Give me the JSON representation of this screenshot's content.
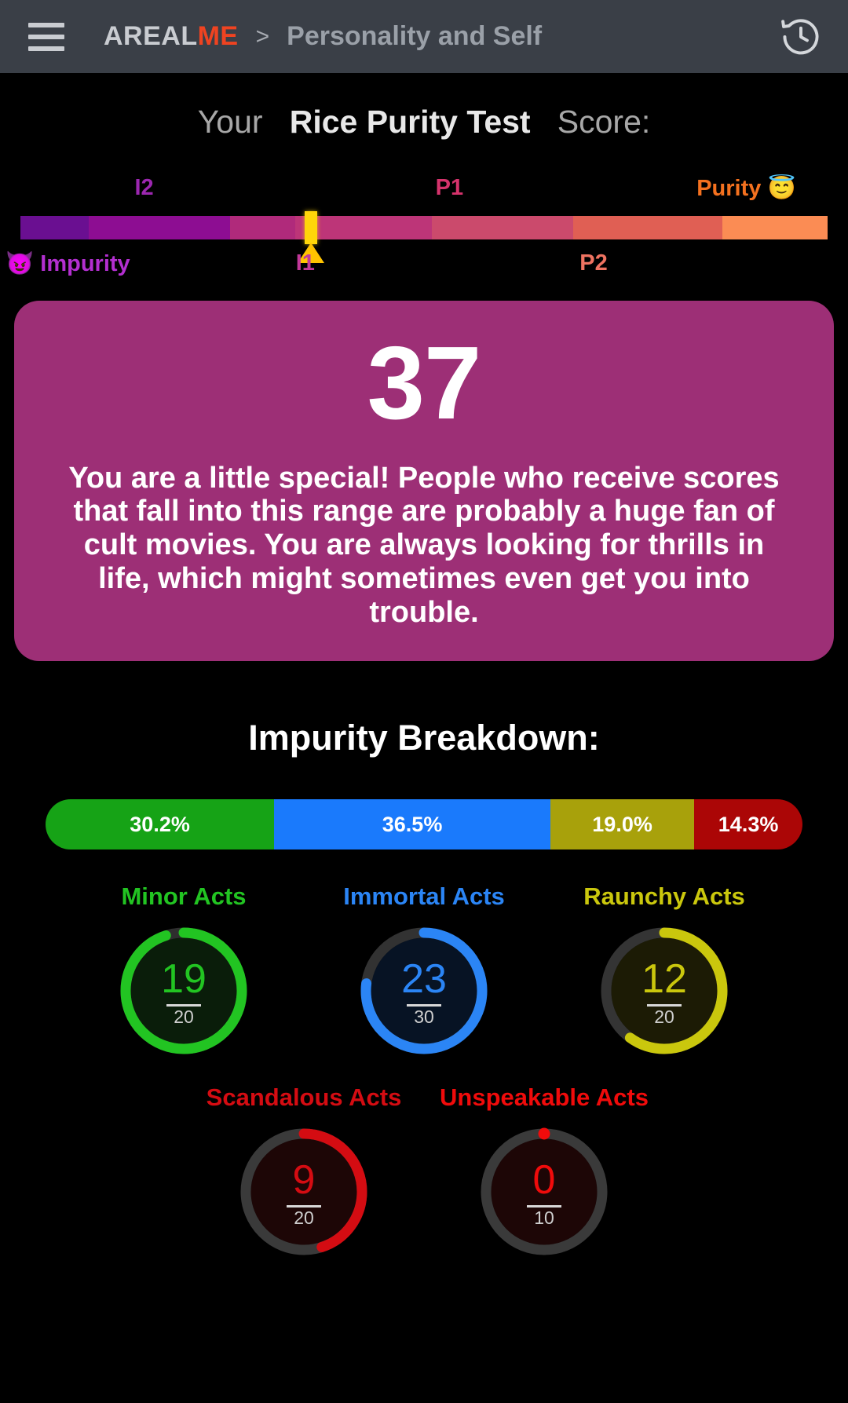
{
  "header": {
    "menu_icon": "hamburger-icon",
    "brand_part1": "AREAL",
    "brand_part2": "ME",
    "separator": ">",
    "breadcrumb": "Personality and Self",
    "history_icon": "history-clock-icon",
    "bg_color": "#3a3f47",
    "brand_accent": "#ef4321"
  },
  "title": {
    "prefix": "Your",
    "test_name": "Rice Purity Test",
    "suffix": "Score:"
  },
  "scale": {
    "top_labels": [
      {
        "text": "I2",
        "color": "#9c27b0",
        "pos_pct": 17
      },
      {
        "text": "P1",
        "color": "#d6336c",
        "pos_pct": 53
      },
      {
        "text": "Purity 😇",
        "color": "#f4711f",
        "pos_pct": 88
      }
    ],
    "bottom_labels": [
      {
        "text": "😈 Impurity",
        "color": "#b32fd0",
        "pos_pct": 8
      },
      {
        "text": "I1",
        "color": "#c2389a",
        "pos_pct": 36
      },
      {
        "text": "P2",
        "color": "#ef7361",
        "pos_pct": 70
      }
    ],
    "segments": [
      {
        "color": "#6a0f91",
        "width_pct": 8.5
      },
      {
        "color": "#8d0d92",
        "width_pct": 17.5
      },
      {
        "color": "#b02a7b",
        "width_pct": 8.0
      },
      {
        "color": "#bd3578",
        "width_pct": 17.0
      },
      {
        "color": "#cb4a6c",
        "width_pct": 17.5
      },
      {
        "color": "#e05f54",
        "width_pct": 18.5
      },
      {
        "color": "#fb8c54",
        "width_pct": 13.0
      }
    ],
    "marker_pct": 36.0,
    "marker_color": "#ffd60a"
  },
  "score_card": {
    "score": "37",
    "description": "You are a little special! People who receive scores that fall into this range are probably a huge fan of cult movies. You are always looking for thrills in life, which might sometimes even get you into trouble.",
    "bg_color": "#9d2f76"
  },
  "breakdown": {
    "heading": "Impurity Breakdown:",
    "segments": [
      {
        "label": "30.2%",
        "value": 30.2,
        "color": "#16a316"
      },
      {
        "label": "36.5%",
        "value": 36.5,
        "color": "#1a7afc"
      },
      {
        "label": "19.0%",
        "value": 19.0,
        "color": "#a8a10b"
      },
      {
        "label": "14.3%",
        "value": 14.3,
        "color": "#ab0606"
      }
    ]
  },
  "chart_data": {
    "type": "pie",
    "title": "Impurity Breakdown",
    "categories": [
      "Minor Acts",
      "Immortal Acts",
      "Raunchy Acts",
      "Scandalous Acts",
      "Unspeakable Acts"
    ],
    "values": [
      30.2,
      36.5,
      19.0,
      14.3,
      0.0
    ],
    "unit": "%",
    "note": "Stacked percentage bar shows only the four non-zero categories: 30.2%, 36.5%, 19.0%, 14.3%",
    "gauges": [
      {
        "name": "Minor Acts",
        "value": 19,
        "max": 20,
        "percent": 95.0,
        "color": "#22c422"
      },
      {
        "name": "Immortal Acts",
        "value": 23,
        "max": 30,
        "percent": 76.7,
        "color": "#2b85f5"
      },
      {
        "name": "Raunchy Acts",
        "value": 12,
        "max": 20,
        "percent": 60.0,
        "color": "#cac70d"
      },
      {
        "name": "Scandalous Acts",
        "value": 9,
        "max": 20,
        "percent": 45.0,
        "color": "#d40c12"
      },
      {
        "name": "Unspeakable Acts",
        "value": 0,
        "max": 10,
        "percent": 0.0,
        "color": "#f00b0b"
      }
    ]
  },
  "gauges_row1": [
    {
      "label": "Minor Acts",
      "value": "19",
      "max": "20",
      "percent": 95,
      "color": "#22c422",
      "track": "#2e2e2e",
      "fill": "#0a1d0a"
    },
    {
      "label": "Immortal Acts",
      "value": "23",
      "max": "30",
      "percent": 77,
      "color": "#2b85f5",
      "track": "#323232",
      "fill": "#071324"
    },
    {
      "label": "Raunchy Acts",
      "value": "12",
      "max": "20",
      "percent": 60,
      "color": "#cac70d",
      "track": "#343434",
      "fill": "#1c1b05"
    }
  ],
  "gauges_row2": [
    {
      "label": "Scandalous Acts",
      "value": "9",
      "max": "20",
      "percent": 45,
      "color": "#d40c12",
      "track": "#3a3a3a",
      "fill": "#1d0606"
    },
    {
      "label": "Unspeakable Acts",
      "value": "0",
      "max": "10",
      "percent": 0,
      "color": "#f00b0b",
      "track": "#3a3a3a",
      "fill": "#1d0606"
    }
  ]
}
